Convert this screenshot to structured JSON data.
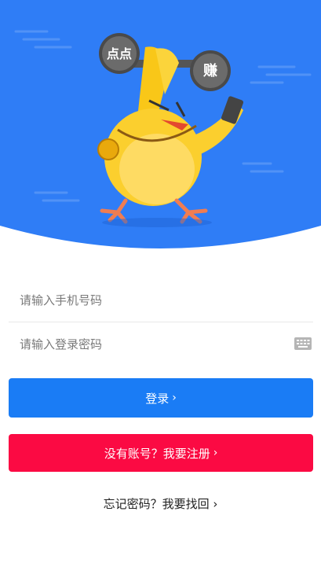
{
  "colors": {
    "hero_blue": "#2f7df6",
    "login_button": "#1a7cf5",
    "register_button": "#fb0a43"
  },
  "hero": {
    "illustration": "yellow-chick-lifting-dumbbell",
    "dumbbell_left_text": "点点",
    "dumbbell_right_text": "赚"
  },
  "form": {
    "phone_placeholder": "请输入手机号码",
    "password_placeholder": "请输入登录密码",
    "keyboard_icon": "keyboard-icon"
  },
  "buttons": {
    "login_label": "登录",
    "register_label": "没有账号？我要注册"
  },
  "links": {
    "forgot_label": "忘记密码？我要找回"
  },
  "chevron": "›"
}
